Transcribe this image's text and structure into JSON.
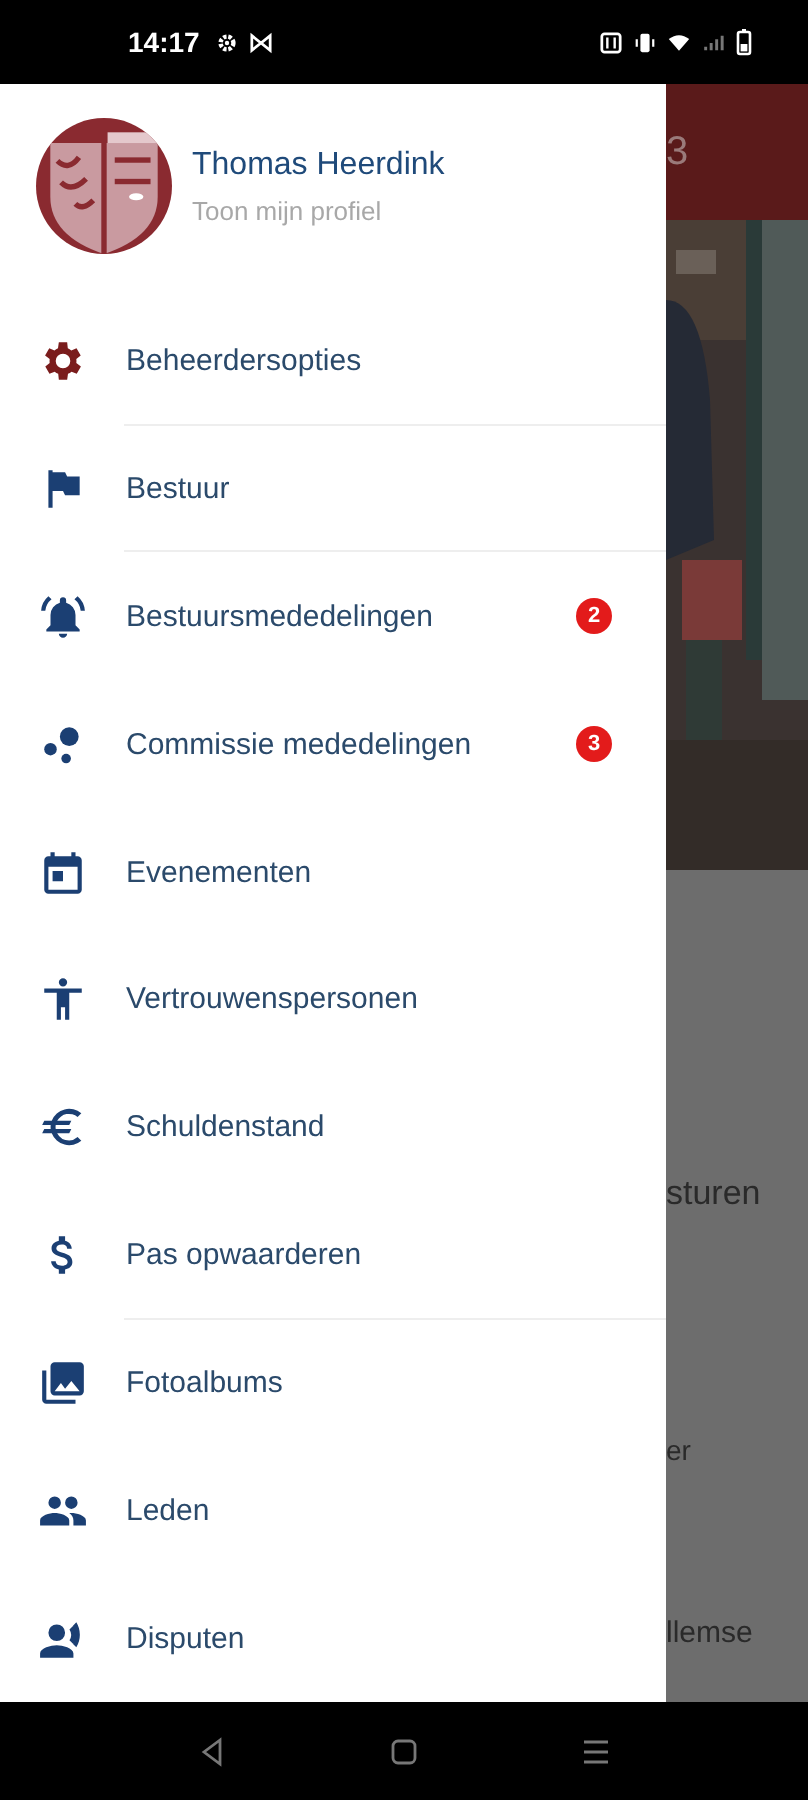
{
  "status_bar": {
    "time": "14:17"
  },
  "drawer": {
    "profile": {
      "name": "Thomas Heerdink",
      "subtitle": "Toon mijn profiel"
    },
    "groups": [
      {
        "items": [
          {
            "label": "Beheerdersopties",
            "kind": "gear",
            "color": "#7a1c1c"
          }
        ]
      },
      {
        "items": [
          {
            "label": "Bestuur",
            "kind": "flag",
            "color": "#1b3f73"
          }
        ]
      },
      {
        "items": [
          {
            "label": "Bestuursmededelingen",
            "kind": "bell",
            "color": "#1b3f73",
            "badge": "2"
          },
          {
            "label": "Commissie mededelingen",
            "kind": "bubbles",
            "color": "#1b3f73",
            "badge": "3"
          },
          {
            "label": "Evenementen",
            "kind": "calendar",
            "color": "#1b3f73"
          },
          {
            "label": "Vertrouwenspersonen",
            "kind": "person",
            "color": "#1b3f73"
          },
          {
            "label": "Schuldenstand",
            "kind": "euro",
            "color": "#1b3f73"
          },
          {
            "label": "Pas opwaarderen",
            "kind": "dollar",
            "color": "#1b3f73"
          }
        ]
      },
      {
        "items": [
          {
            "label": "Fotoalbums",
            "kind": "photos",
            "color": "#1b3f73"
          },
          {
            "label": "Leden",
            "kind": "people",
            "color": "#1b3f73"
          },
          {
            "label": "Disputen",
            "kind": "speaker",
            "color": "#1b3f73"
          }
        ]
      }
    ]
  },
  "background": {
    "header_text": "3",
    "texts": [
      "sturen",
      "er",
      "llemse"
    ]
  }
}
